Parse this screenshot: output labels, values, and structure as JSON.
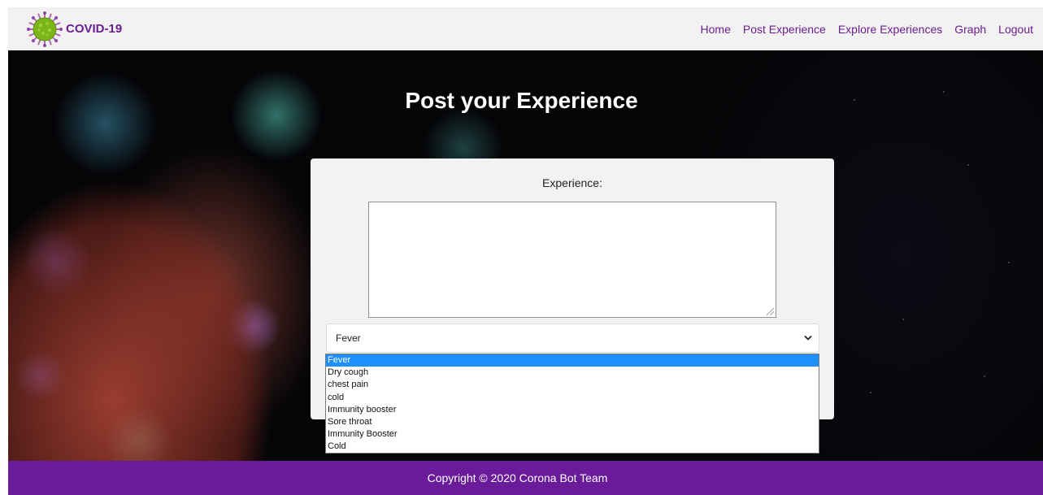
{
  "brand": {
    "name": "COVID-19",
    "logo_icon": "virus-icon",
    "logo_color": "#7cb518",
    "text_color": "#6b1d8f"
  },
  "nav": {
    "items": [
      {
        "label": "Home"
      },
      {
        "label": "Post Experience"
      },
      {
        "label": "Explore Experiences"
      },
      {
        "label": "Graph"
      },
      {
        "label": "Logout"
      }
    ]
  },
  "hero": {
    "title": "Post your Experience"
  },
  "form": {
    "experience_label": "Experience:",
    "experience_value": "",
    "symptom_select": {
      "selected": "Fever",
      "options": [
        "Fever",
        "Dry cough",
        "chest pain",
        "cold",
        "Immunity booster",
        "Sore throat",
        "Immunity Booster",
        "Cold"
      ]
    }
  },
  "footer": {
    "copyright": "Copyright © 2020 Corona Bot Team",
    "bg_color": "#6a1b9a"
  },
  "colors": {
    "accent": "#6b1d8f",
    "selected_option": "#1e90ff"
  }
}
